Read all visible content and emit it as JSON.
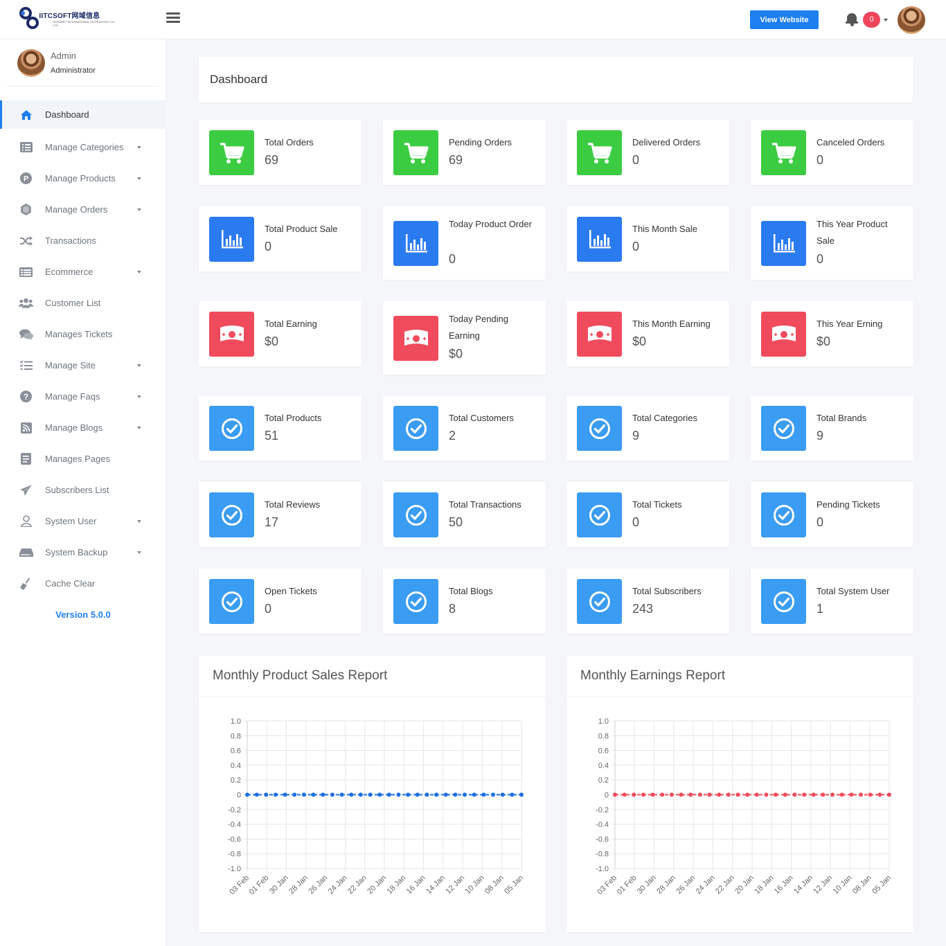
{
  "header": {
    "logo_brand": "IITCSOFT网域信息",
    "logo_sub": "INTERNET INTERNATIONAL TECHNOLOGY CO., LTD.",
    "view_website_label": "View Website",
    "notification_count": "0"
  },
  "sidebar": {
    "user_name": "Admin",
    "user_role": "Administrator",
    "items": [
      {
        "label": "Dashboard",
        "icon": "home-icon",
        "active": true,
        "dropdown": false
      },
      {
        "label": "Manage Categories",
        "icon": "list-icon",
        "dropdown": true
      },
      {
        "label": "Manage Products",
        "icon": "product-icon",
        "dropdown": true
      },
      {
        "label": "Manage Orders",
        "icon": "orders-icon",
        "dropdown": true
      },
      {
        "label": "Transactions",
        "icon": "shuffle-icon",
        "dropdown": false
      },
      {
        "label": "Ecommerce",
        "icon": "ecommerce-icon",
        "dropdown": true
      },
      {
        "label": "Customer List",
        "icon": "users-icon",
        "dropdown": false
      },
      {
        "label": "Manages Tickets",
        "icon": "comments-icon",
        "dropdown": false
      },
      {
        "label": "Manage Site",
        "icon": "tasks-icon",
        "dropdown": true
      },
      {
        "label": "Manage Faqs",
        "icon": "question-icon",
        "dropdown": true
      },
      {
        "label": "Manage Blogs",
        "icon": "rss-icon",
        "dropdown": true
      },
      {
        "label": "Manages Pages",
        "icon": "page-icon",
        "dropdown": false
      },
      {
        "label": "Subscribers List",
        "icon": "send-icon",
        "dropdown": false
      },
      {
        "label": "System User",
        "icon": "user-icon",
        "dropdown": true
      },
      {
        "label": "System Backup",
        "icon": "hdd-icon",
        "dropdown": true
      },
      {
        "label": "Cache Clear",
        "icon": "broom-icon",
        "dropdown": false
      }
    ],
    "version": "Version 5.0.0"
  },
  "page_title": "Dashboard",
  "stats": [
    [
      {
        "label": "Total Orders",
        "value": "69",
        "icon": "cart-icon",
        "color": "green"
      },
      {
        "label": "Pending Orders",
        "value": "69",
        "icon": "cart-icon",
        "color": "green"
      },
      {
        "label": "Delivered Orders",
        "value": "0",
        "icon": "cart-icon",
        "color": "green"
      },
      {
        "label": "Canceled Orders",
        "value": "0",
        "icon": "cart-icon",
        "color": "green"
      }
    ],
    [
      {
        "label": "Total Product Sale",
        "value": "0",
        "icon": "bar-chart-icon",
        "color": "blue"
      },
      {
        "label": "Today Product Order",
        "value": "0",
        "icon": "bar-chart-icon",
        "color": "blue"
      },
      {
        "label": "This Month Sale",
        "value": "0",
        "icon": "bar-chart-icon",
        "color": "blue"
      },
      {
        "label": "This Year Product Sale",
        "value": "0",
        "icon": "bar-chart-icon",
        "color": "blue"
      }
    ],
    [
      {
        "label": "Total Earning",
        "value": "$0",
        "icon": "money-icon",
        "color": "red"
      },
      {
        "label": "Today Pending Earning",
        "value": "$0",
        "icon": "money-icon",
        "color": "red"
      },
      {
        "label": "This Month Earning",
        "value": "$0",
        "icon": "money-icon",
        "color": "red"
      },
      {
        "label": "This Year Erning",
        "value": "$0",
        "icon": "money-icon",
        "color": "red"
      }
    ],
    [
      {
        "label": "Total Products",
        "value": "51",
        "icon": "check-circle-icon",
        "color": "sky"
      },
      {
        "label": "Total Customers",
        "value": "2",
        "icon": "check-circle-icon",
        "color": "sky"
      },
      {
        "label": "Total Categories",
        "value": "9",
        "icon": "check-circle-icon",
        "color": "sky"
      },
      {
        "label": "Total Brands",
        "value": "9",
        "icon": "check-circle-icon",
        "color": "sky"
      }
    ],
    [
      {
        "label": "Total Reviews",
        "value": "17",
        "icon": "check-circle-icon",
        "color": "sky"
      },
      {
        "label": "Total Transactions",
        "value": "50",
        "icon": "check-circle-icon",
        "color": "sky"
      },
      {
        "label": "Total Tickets",
        "value": "0",
        "icon": "check-circle-icon",
        "color": "sky"
      },
      {
        "label": "Pending Tickets",
        "value": "0",
        "icon": "check-circle-icon",
        "color": "sky"
      }
    ],
    [
      {
        "label": "Open Tickets",
        "value": "0",
        "icon": "check-circle-icon",
        "color": "sky"
      },
      {
        "label": "Total Blogs",
        "value": "8",
        "icon": "check-circle-icon",
        "color": "sky"
      },
      {
        "label": "Total Subscribers",
        "value": "243",
        "icon": "check-circle-icon",
        "color": "sky"
      },
      {
        "label": "Total System User",
        "value": "1",
        "icon": "check-circle-icon",
        "color": "sky"
      }
    ]
  ],
  "colors": {
    "accent": "#1d7ff0",
    "green": "#3ccc42",
    "blue": "#2b7bf0",
    "red": "#ef4b5c",
    "sky": "#3a9cf2",
    "sales_line": "#1d6fe0",
    "earnings_line": "#ef4b5c"
  },
  "chart_data": [
    {
      "type": "line",
      "title": "Monthly Product Sales Report",
      "categories": [
        "03 Feb",
        "01 Feb",
        "30 Jan",
        "28 Jan",
        "26 Jan",
        "24 Jan",
        "22 Jan",
        "20 Jan",
        "18 Jan",
        "16 Jan",
        "14 Jan",
        "12 Jan",
        "10 Jan",
        "08 Jan",
        "05 Jan"
      ],
      "series": [
        {
          "values": [
            0,
            0,
            0,
            0,
            0,
            0,
            0,
            0,
            0,
            0,
            0,
            0,
            0,
            0,
            0,
            0,
            0,
            0,
            0,
            0,
            0,
            0,
            0,
            0,
            0,
            0,
            0,
            0,
            0,
            0
          ]
        }
      ],
      "ylim": [
        -1.0,
        1.0
      ],
      "yticks": [
        "1.0",
        "0.8",
        "0.6",
        "0.4",
        "0.2",
        "0",
        "-0.2",
        "-0.4",
        "-0.6",
        "-0.8",
        "-1.0"
      ],
      "grid": true,
      "line_style": "dashed",
      "color": "#1d6fe0"
    },
    {
      "type": "line",
      "title": "Monthly Earnings Report",
      "categories": [
        "03 Feb",
        "01 Feb",
        "30 Jan",
        "28 Jan",
        "26 Jan",
        "24 Jan",
        "22 Jan",
        "20 Jan",
        "18 Jan",
        "16 Jan",
        "14 Jan",
        "12 Jan",
        "10 Jan",
        "08 Jan",
        "05 Jan"
      ],
      "series": [
        {
          "values": [
            0,
            0,
            0,
            0,
            0,
            0,
            0,
            0,
            0,
            0,
            0,
            0,
            0,
            0,
            0,
            0,
            0,
            0,
            0,
            0,
            0,
            0,
            0,
            0,
            0,
            0,
            0,
            0,
            0,
            0
          ]
        }
      ],
      "ylim": [
        -1.0,
        1.0
      ],
      "yticks": [
        "1.0",
        "0.8",
        "0.6",
        "0.4",
        "0.2",
        "0",
        "-0.2",
        "-0.4",
        "-0.6",
        "-0.8",
        "-1.0"
      ],
      "grid": true,
      "line_style": "dashed",
      "color": "#ef4b5c"
    }
  ]
}
